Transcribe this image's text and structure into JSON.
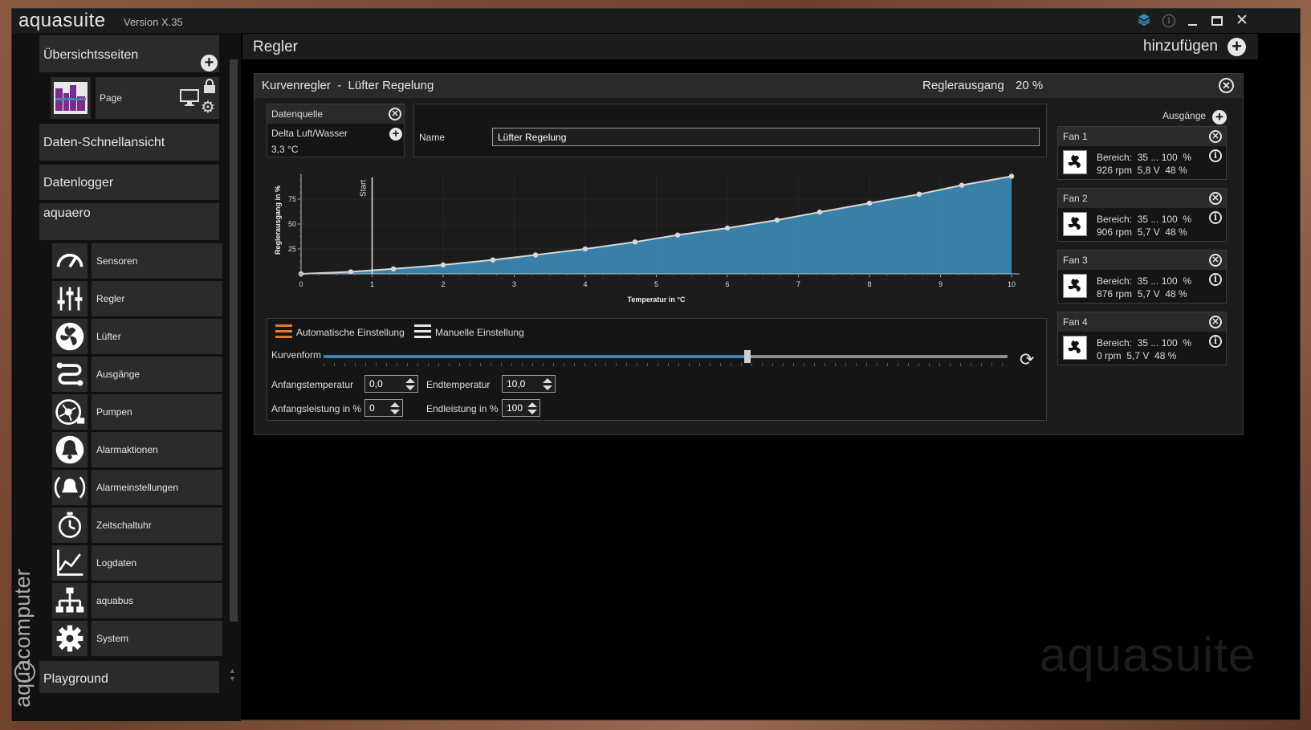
{
  "app": {
    "title": "aquasuite",
    "version": "Version X.35",
    "brand_vertical": "aquacomputer",
    "watermark": "aquasuite"
  },
  "sidebar": {
    "overview_title": "Übersichtsseiten",
    "page_label": "Page",
    "quick_view": "Daten-Schnellansicht",
    "datalogger": "Datenlogger",
    "device": "aquaero",
    "items": [
      {
        "label": "Sensoren",
        "icon": "gauge-icon"
      },
      {
        "label": "Regler",
        "icon": "sliders-icon"
      },
      {
        "label": "Lüfter",
        "icon": "fan-icon"
      },
      {
        "label": "Ausgänge",
        "icon": "outputs-icon"
      },
      {
        "label": "Pumpen",
        "icon": "pump-icon"
      },
      {
        "label": "Alarmaktionen",
        "icon": "alarm-bell-icon"
      },
      {
        "label": "Alarmeinstellungen",
        "icon": "alarm-settings-icon"
      },
      {
        "label": "Zeitschaltuhr",
        "icon": "timer-icon"
      },
      {
        "label": "Logdaten",
        "icon": "chart-line-icon"
      },
      {
        "label": "aquabus",
        "icon": "network-icon"
      },
      {
        "label": "System",
        "icon": "gear-icon"
      }
    ],
    "playground": "Playground"
  },
  "header": {
    "title": "Regler",
    "add_label": "hinzufügen"
  },
  "panel": {
    "title": "Kurvenregler  -  Lüfter Regelung",
    "output_label": "Reglerausgang",
    "output_value": "20 %",
    "datasource": {
      "title": "Datenquelle",
      "source": "Delta Luft/Wasser",
      "value": "3,3 °C"
    },
    "name_label": "Name",
    "name_value": "Lüfter Regelung",
    "outputs_label": "Ausgänge",
    "mode_auto": "Automatische Einstellung",
    "mode_manual": "Manuelle Einstellung",
    "curve_label": "Kurvenform",
    "curve_slider": 0.62,
    "start_temp_label": "Anfangstemperatur",
    "start_temp": "0,0",
    "end_temp_label": "Endtemperatur",
    "end_temp": "10,0",
    "start_power_label": "Anfangsleistung in %",
    "start_power": "0",
    "end_power_label": "Endleistung in %",
    "end_power": "100"
  },
  "fans": [
    {
      "name": "Fan 1",
      "range": "Bereich:  35 ... 100  %",
      "status": "926 rpm  5,8 V  48 %"
    },
    {
      "name": "Fan 2",
      "range": "Bereich:  35 ... 100  %",
      "status": "906 rpm  5,7 V  48 %"
    },
    {
      "name": "Fan 3",
      "range": "Bereich:  35 ... 100  %",
      "status": "876 rpm  5,7 V  48 %"
    },
    {
      "name": "Fan 4",
      "range": "Bereich:  35 ... 100  %",
      "status": "0 rpm  5,7 V  48 %"
    }
  ],
  "colors": {
    "accent": "#3a86b0",
    "orange": "#e87722",
    "panel": "#1c1c1c"
  },
  "chart_data": {
    "type": "area",
    "xlabel": "Temperatur in °C",
    "ylabel": "Reglerausgang in %",
    "start_marker_label": "Start",
    "start_marker_x": 1,
    "xlim": [
      0,
      10
    ],
    "ylim": [
      0,
      100
    ],
    "xticks": [
      0,
      1,
      2,
      3,
      4,
      5,
      6,
      7,
      8,
      9,
      10
    ],
    "yticks": [
      25,
      50,
      75
    ],
    "x": [
      0,
      0.7,
      1.3,
      2.0,
      2.7,
      3.3,
      4.0,
      4.7,
      5.3,
      6.0,
      6.7,
      7.3,
      8.0,
      8.7,
      9.3,
      10.0
    ],
    "y": [
      0,
      2,
      5,
      9,
      14,
      19,
      25,
      32,
      39,
      46,
      54,
      62,
      71,
      80,
      89,
      98
    ]
  }
}
